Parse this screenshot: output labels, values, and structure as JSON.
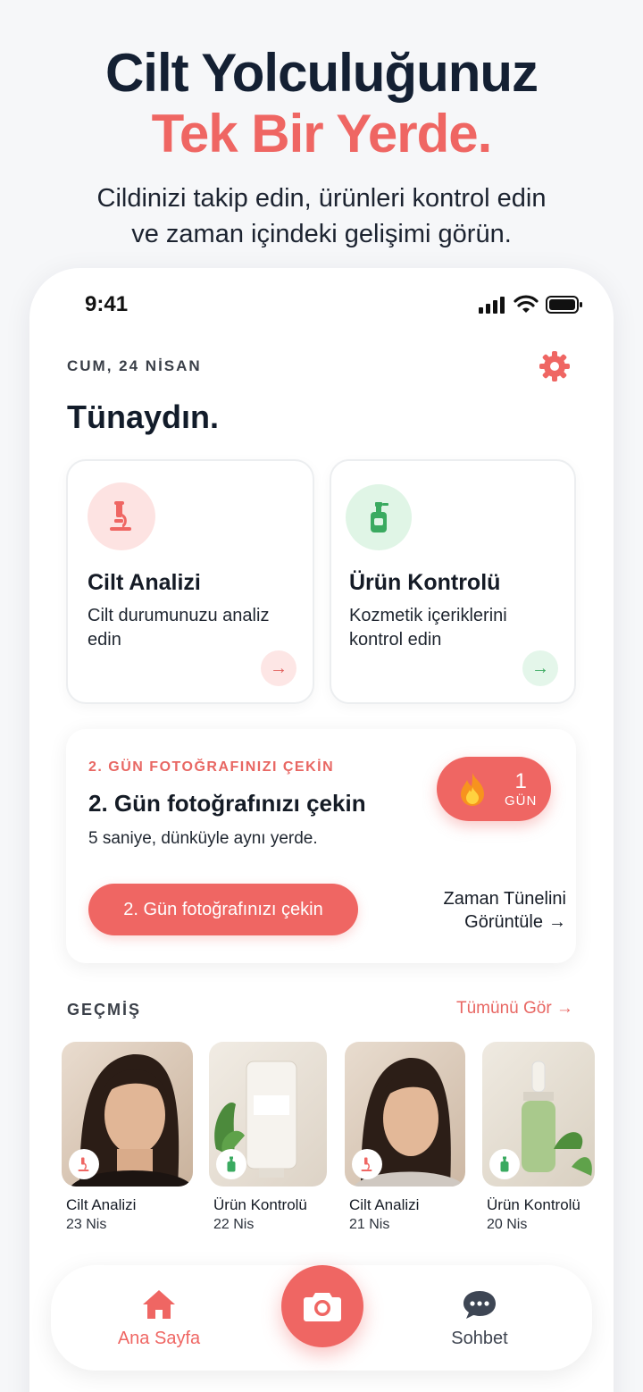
{
  "hero": {
    "title_line1": "Cilt Yolculuğunuz",
    "title_line2": "Tek Bir Yerde.",
    "subtitle_line1": "Cildinizi takip edin, ürünleri kontrol edin",
    "subtitle_line2": "ve zaman içindeki gelişimi görün."
  },
  "status_bar": {
    "time": "9:41"
  },
  "header": {
    "date": "CUM, 24 NİSAN",
    "greeting": "Tünaydın.",
    "settings_icon": "gear-icon"
  },
  "cards": [
    {
      "title": "Cilt Analizi",
      "description": "Cilt durumunuzu analiz edin",
      "icon": "microscope-icon",
      "accent": "#ef6663"
    },
    {
      "title": "Ürün Kontrolü",
      "description": "Kozmetik içeriklerini kontrol edin",
      "icon": "bottle-icon",
      "accent": "#3aaa60"
    }
  ],
  "daily": {
    "kicker": "2. GÜN FOTOĞRAFINIZI ÇEKİN",
    "title": "2. Gün fotoğrafınızı çekin",
    "description": "5 saniye, dünküyle aynı yerde.",
    "streak_count": "1",
    "streak_unit": "GÜN",
    "button": "2. Gün fotoğrafınızı çekin",
    "timeline_line1": "Zaman Tünelini",
    "timeline_line2": "Görüntüle",
    "timeline_arrow": "→"
  },
  "history": {
    "title": "GEÇMİŞ",
    "see_all": "Tümünü Gör →",
    "items": [
      {
        "title": "Cilt Analizi",
        "date": "23 Nis",
        "icon": "microscope-icon"
      },
      {
        "title": "Ürün Kontrolü",
        "date": "22 Nis",
        "icon": "bottle-icon"
      },
      {
        "title": "Cilt Analizi",
        "date": "21 Nis",
        "icon": "microscope-icon"
      },
      {
        "title": "Ürün Kontrolü",
        "date": "20 Nis",
        "icon": "bottle-icon"
      }
    ]
  },
  "nav": {
    "home": "Ana Sayfa",
    "chat": "Sohbet",
    "camera_icon": "camera-icon"
  },
  "colors": {
    "accent": "#ef6663",
    "green": "#3aaa60",
    "text": "#111b29"
  }
}
